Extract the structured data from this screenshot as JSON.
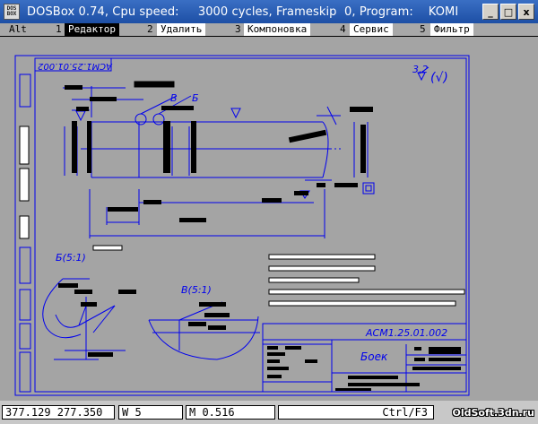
{
  "window": {
    "icon_text": "DOS BOX",
    "title": "DOSBox 0.74, Cpu speed:     3000 cycles, Frameskip  0, Program:    KOMI",
    "minimize": "_",
    "maximize": "□",
    "close": "x"
  },
  "menu": {
    "alt_label": "Alt",
    "items": [
      {
        "num": "1",
        "label": "Редактор"
      },
      {
        "num": "2",
        "label": "Удалить"
      },
      {
        "num": "3",
        "label": "Компоновка"
      },
      {
        "num": "4",
        "label": "Сервис"
      },
      {
        "num": "5",
        "label": "Фильтр"
      }
    ]
  },
  "drawing": {
    "code_rotated": "АСМ1.25.01.002",
    "roughness": "3,2",
    "roughness_mark": "(√)",
    "label_v": "В",
    "label_b": "Б",
    "detail_b": "Б(5:1)",
    "detail_v": "В(5:1)",
    "title_code": "АСМ1.25.01.002",
    "title_name": "Боек"
  },
  "status": {
    "coords": "377.129 277.350",
    "w": "W 5",
    "m": "M 0.516",
    "hotkey": "Ctrl/F3"
  },
  "watermark": "OldSoft.3dn.ru",
  "colors": {
    "canvas": "#a4a4a4",
    "lines": "#0000ee",
    "fills": "#000000"
  }
}
